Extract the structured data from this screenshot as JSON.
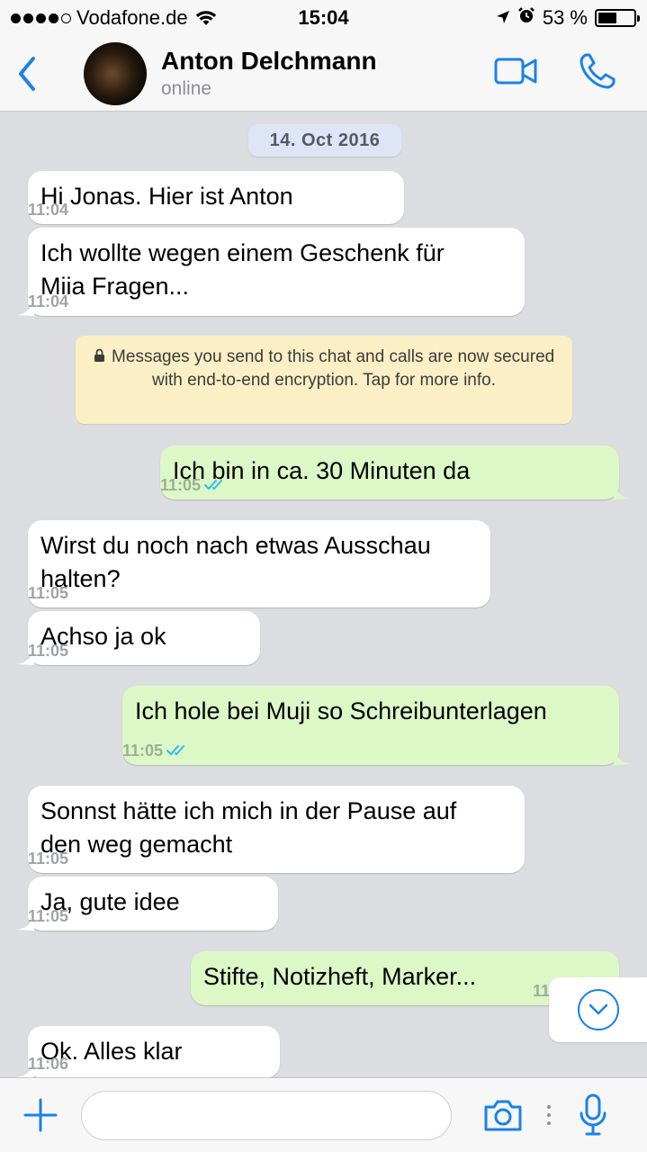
{
  "status_bar": {
    "carrier": "Vodafone.de",
    "time": "15:04",
    "battery_percent": "53 %",
    "battery_level": 0.53,
    "signal_bars_filled": 4,
    "signal_bars_total": 5
  },
  "header": {
    "contact_name": "Anton Delchmann",
    "contact_status": "online"
  },
  "chat": {
    "date_chip": "14. Oct 2016",
    "system_message": "Messages you send to this chat and calls are now secured with end-to-end encryption. Tap for more info.",
    "messages": [
      {
        "direction": "in",
        "text": "Hi Jonas. Hier ist Anton",
        "time": "11:04"
      },
      {
        "direction": "in",
        "text": "Ich wollte wegen einem Geschenk für\nMiia Fragen...",
        "time": "11:04"
      },
      {
        "direction": "out",
        "text": "Ich bin in ca. 30 Minuten da",
        "time": "11:05",
        "read": true
      },
      {
        "direction": "in",
        "text": "Wirst du noch nach etwas Ausschau\nhalten?",
        "time": "11:05"
      },
      {
        "direction": "in",
        "text": "Achso ja ok",
        "time": "11:05"
      },
      {
        "direction": "out",
        "text": "Ich hole bei Muji so Schreibunterlagen",
        "time": "11:05",
        "read": true
      },
      {
        "direction": "in",
        "text": "Sonnst hätte ich mich in der Pause auf\nden weg gemacht",
        "time": "11:05"
      },
      {
        "direction": "in",
        "text": "Ja, gute idee",
        "time": "11:05"
      },
      {
        "direction": "out",
        "text": "Stifte, Notizheft, Marker...",
        "time": "11"
      },
      {
        "direction": "in",
        "text": "Ok. Alles klar",
        "time": "11:06"
      }
    ]
  },
  "input": {
    "placeholder": "",
    "value": ""
  },
  "colors": {
    "accent": "#1a82e8",
    "incoming_bubble": "#ffffff",
    "outgoing_bubble": "#dcf8c7",
    "chat_background": "#dbdde0",
    "encryption_notice": "#fbf0c5",
    "date_chip": "#dde5f6",
    "read_receipt": "#34b7f1"
  },
  "icons": {
    "back": "chevron-left-icon",
    "video_call": "video-camera-icon",
    "voice_call": "phone-icon",
    "attach": "plus-icon",
    "camera": "camera-icon",
    "microphone": "microphone-icon",
    "scroll_down": "chevron-down-icon",
    "lock": "lock-icon",
    "read_receipt": "double-check-icon"
  }
}
